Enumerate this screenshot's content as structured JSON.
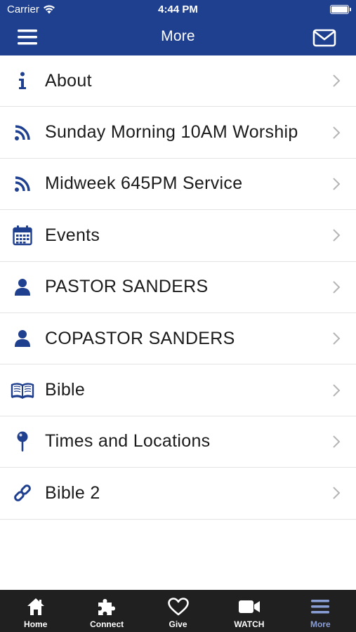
{
  "status_bar": {
    "carrier": "Carrier",
    "time": "4:44 PM"
  },
  "header": {
    "title": "More",
    "menu_icon": "hamburger-icon",
    "mail_icon": "envelope-icon"
  },
  "colors": {
    "brand": "#1f3f8f",
    "tabbar": "#202020",
    "tab_active": "#8a9ed6"
  },
  "menu": {
    "items": [
      {
        "label": "About",
        "icon": "info-icon"
      },
      {
        "label": "Sunday Morning 10AM Worship",
        "icon": "rss-icon"
      },
      {
        "label": "Midweek 645PM Service",
        "icon": "rss-icon"
      },
      {
        "label": "Events",
        "icon": "calendar-icon"
      },
      {
        "label": "PASTOR SANDERS",
        "icon": "user-icon"
      },
      {
        "label": "COPASTOR SANDERS",
        "icon": "user-icon"
      },
      {
        "label": "Bible",
        "icon": "book-icon"
      },
      {
        "label": "Times and Locations",
        "icon": "map-pin-icon"
      },
      {
        "label": "Bible 2",
        "icon": "link-icon"
      }
    ]
  },
  "tabbar": {
    "active": "More",
    "tabs": [
      {
        "label": "Home",
        "icon": "home-icon"
      },
      {
        "label": "Connect",
        "icon": "puzzle-icon"
      },
      {
        "label": "Give",
        "icon": "heart-icon"
      },
      {
        "label": "WATCH",
        "icon": "video-camera-icon"
      },
      {
        "label": "More",
        "icon": "menu-icon"
      }
    ]
  }
}
